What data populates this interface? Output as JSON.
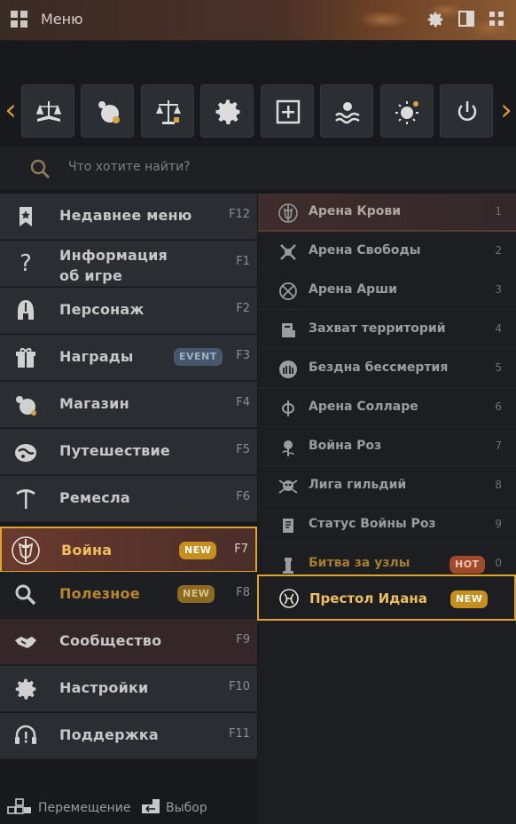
{
  "header": {
    "title": "Меню",
    "icons": [
      "grid-icon",
      "gear-icon",
      "panel-icon",
      "apps-icon"
    ]
  },
  "quickbar": {
    "icons": [
      "book-scales-icon",
      "orb-icon",
      "scales-icon",
      "gear-icon",
      "plus-box-icon",
      "water-hand-icon",
      "sun-icon",
      "power-icon"
    ]
  },
  "search": {
    "placeholder": "Что хотите найти?"
  },
  "menu": [
    {
      "label": "Недавнее меню",
      "key": "F12",
      "icon": "bookmark-icon"
    },
    {
      "label": "Информация об игре",
      "key": "F1",
      "icon": "question-icon"
    },
    {
      "label": "Персонаж",
      "key": "F2",
      "icon": "helmet-icon"
    },
    {
      "label": "Награды",
      "key": "F3",
      "icon": "gift-icon",
      "badge": "EVENT"
    },
    {
      "label": "Магазин",
      "key": "F4",
      "icon": "shop-icon"
    },
    {
      "label": "Путешествие",
      "key": "F5",
      "icon": "travel-icon"
    },
    {
      "label": "Ремесла",
      "key": "F6",
      "icon": "pickaxe-icon"
    },
    {
      "label": "Война",
      "key": "F7",
      "icon": "war-shield-icon",
      "badge": "NEW"
    },
    {
      "label": "Полезное",
      "key": "F8",
      "icon": "search-icon",
      "badge": "NEW"
    },
    {
      "label": "Сообщество",
      "key": "F9",
      "icon": "handshake-icon"
    },
    {
      "label": "Настройки",
      "key": "F10",
      "icon": "gear-icon"
    },
    {
      "label": "Поддержка",
      "key": "F11",
      "icon": "headset-icon"
    }
  ],
  "submenu": [
    {
      "label": "Арена Крови",
      "num": "1"
    },
    {
      "label": "Арена Свободы",
      "num": "2"
    },
    {
      "label": "Арена Арши",
      "num": "3"
    },
    {
      "label": "Захват территорий",
      "num": "4"
    },
    {
      "label": "Бездна бессмертия",
      "num": "5"
    },
    {
      "label": "Арена Соллаpе",
      "num": "6"
    },
    {
      "label": "Война Роз",
      "num": "7"
    },
    {
      "label": "Лига гильдий",
      "num": "8"
    },
    {
      "label": "Статус Войны Роз",
      "num": "9"
    },
    {
      "label": "Битва за узлы",
      "num": "0",
      "badge": "HOT"
    },
    {
      "label": "Престол Идана",
      "badge": "NEW"
    }
  ],
  "footer": {
    "move": "Перемещение",
    "select": "Выбор"
  },
  "colors": {
    "accent": "#e0a528",
    "badge_new": "#c7901e",
    "badge_hot": "#a14a2a",
    "badge_event": "#46566b"
  }
}
